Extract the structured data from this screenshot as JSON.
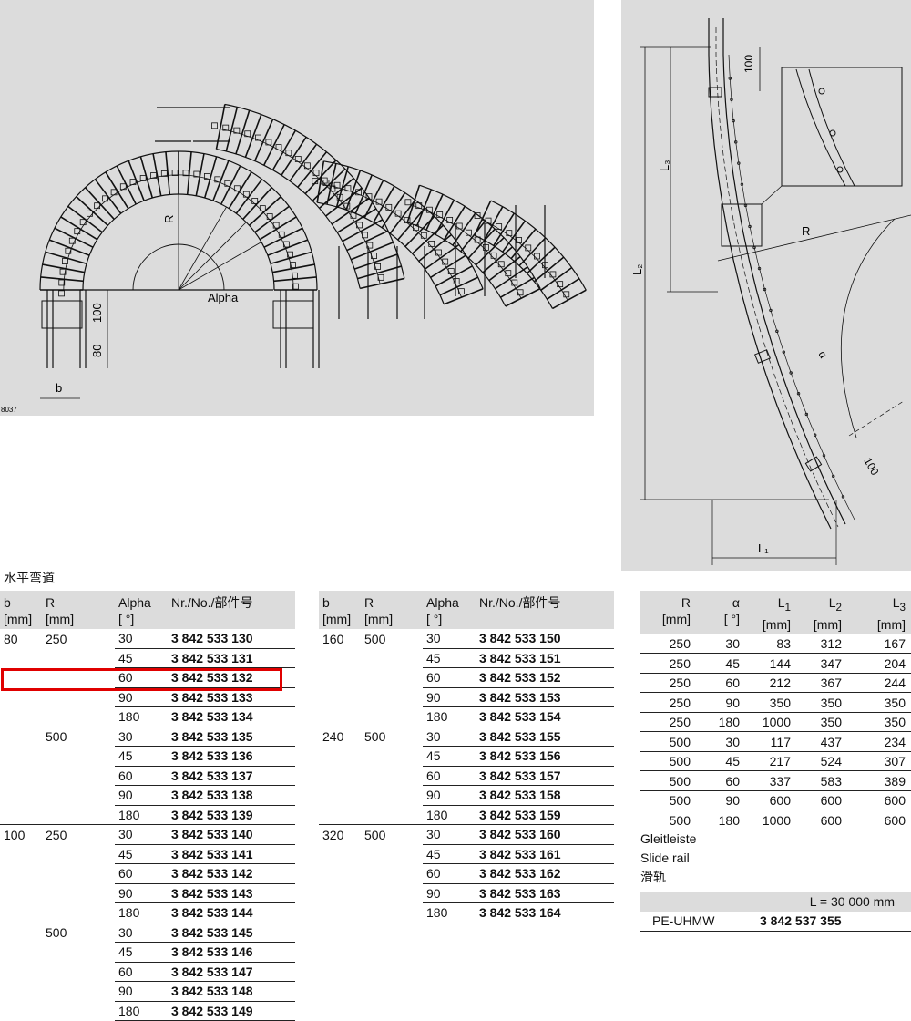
{
  "drawing_left": {
    "code": "8037",
    "label_alpha": "Alpha",
    "label_r": "R",
    "label_b": "b",
    "dim_100": "100",
    "dim_80": "80"
  },
  "drawing_right": {
    "label_r": "R",
    "label_alpha": "α",
    "label_l1": "L₁",
    "label_l2": "L₂",
    "label_l3": "L₃",
    "dim_100_top": "100",
    "dim_100_bottom": "100"
  },
  "section_title": "水平弯道",
  "table_a": {
    "headers": {
      "b": "b",
      "b_unit": "[mm]",
      "r": "R",
      "r_unit": "[mm]",
      "alpha": "Alpha",
      "alpha_unit": "[ °]",
      "nr": "Nr./No./部件号"
    },
    "rows": [
      [
        "80",
        "250",
        "30",
        "3 842 533 130"
      ],
      [
        "",
        "",
        "45",
        "3 842 533 131"
      ],
      [
        "",
        "",
        "60",
        "3 842 533 132"
      ],
      [
        "",
        "",
        "90",
        "3 842 533 133"
      ],
      [
        "",
        "",
        "180",
        "3 842 533 134"
      ],
      [
        "",
        "500",
        "30",
        "3 842 533 135"
      ],
      [
        "",
        "",
        "45",
        "3 842 533 136"
      ],
      [
        "",
        "",
        "60",
        "3 842 533 137"
      ],
      [
        "",
        "",
        "90",
        "3 842 533 138"
      ],
      [
        "",
        "",
        "180",
        "3 842 533 139"
      ],
      [
        "100",
        "250",
        "30",
        "3 842 533 140"
      ],
      [
        "",
        "",
        "45",
        "3 842 533 141"
      ],
      [
        "",
        "",
        "60",
        "3 842 533 142"
      ],
      [
        "",
        "",
        "90",
        "3 842 533 143"
      ],
      [
        "",
        "",
        "180",
        "3 842 533 144"
      ],
      [
        "",
        "500",
        "30",
        "3 842 533 145"
      ],
      [
        "",
        "",
        "45",
        "3 842 533 146"
      ],
      [
        "",
        "",
        "60",
        "3 842 533 147"
      ],
      [
        "",
        "",
        "90",
        "3 842 533 148"
      ],
      [
        "",
        "",
        "180",
        "3 842 533 149"
      ]
    ]
  },
  "table_b": {
    "headers": {
      "b": "b",
      "b_unit": "[mm]",
      "r": "R",
      "r_unit": "[mm]",
      "alpha": "Alpha",
      "alpha_unit": "[ °]",
      "nr": "Nr./No./部件号"
    },
    "rows": [
      [
        "160",
        "500",
        "30",
        "3 842 533 150"
      ],
      [
        "",
        "",
        "45",
        "3 842 533 151"
      ],
      [
        "",
        "",
        "60",
        "3 842 533 152"
      ],
      [
        "",
        "",
        "90",
        "3 842 533 153"
      ],
      [
        "",
        "",
        "180",
        "3 842 533 154"
      ],
      [
        "240",
        "500",
        "30",
        "3 842 533 155"
      ],
      [
        "",
        "",
        "45",
        "3 842 533 156"
      ],
      [
        "",
        "",
        "60",
        "3 842 533 157"
      ],
      [
        "",
        "",
        "90",
        "3 842 533 158"
      ],
      [
        "",
        "",
        "180",
        "3 842 533 159"
      ],
      [
        "320",
        "500",
        "30",
        "3 842 533 160"
      ],
      [
        "",
        "",
        "45",
        "3 842 533 161"
      ],
      [
        "",
        "",
        "60",
        "3 842 533 162"
      ],
      [
        "",
        "",
        "90",
        "3 842 533 163"
      ],
      [
        "",
        "",
        "180",
        "3 842 533 164"
      ]
    ]
  },
  "table_c": {
    "headers": {
      "r": "R",
      "r_unit": "[mm]",
      "alpha": "α",
      "alpha_unit": "[ °]",
      "l1": "L",
      "l1_sub": "1",
      "l1_unit": "[mm]",
      "l2": "L",
      "l2_sub": "2",
      "l2_unit": "[mm]",
      "l3": "L",
      "l3_sub": "3",
      "l3_unit": "[mm]"
    },
    "rows": [
      [
        "250",
        "30",
        "83",
        "312",
        "167"
      ],
      [
        "250",
        "45",
        "144",
        "347",
        "204"
      ],
      [
        "250",
        "60",
        "212",
        "367",
        "244"
      ],
      [
        "250",
        "90",
        "350",
        "350",
        "350"
      ],
      [
        "250",
        "180",
        "1000",
        "350",
        "350"
      ],
      [
        "500",
        "30",
        "117",
        "437",
        "234"
      ],
      [
        "500",
        "45",
        "217",
        "524",
        "307"
      ],
      [
        "500",
        "60",
        "337",
        "583",
        "389"
      ],
      [
        "500",
        "90",
        "600",
        "600",
        "600"
      ],
      [
        "500",
        "180",
        "1000",
        "600",
        "600"
      ]
    ]
  },
  "slide_rail": {
    "title_de": "Gleitleiste",
    "title_en": "Slide rail",
    "title_cn": "滑轨",
    "length": "L = 30 000 mm",
    "material": "PE-UHMW",
    "part_no": "3 842 537 355"
  }
}
